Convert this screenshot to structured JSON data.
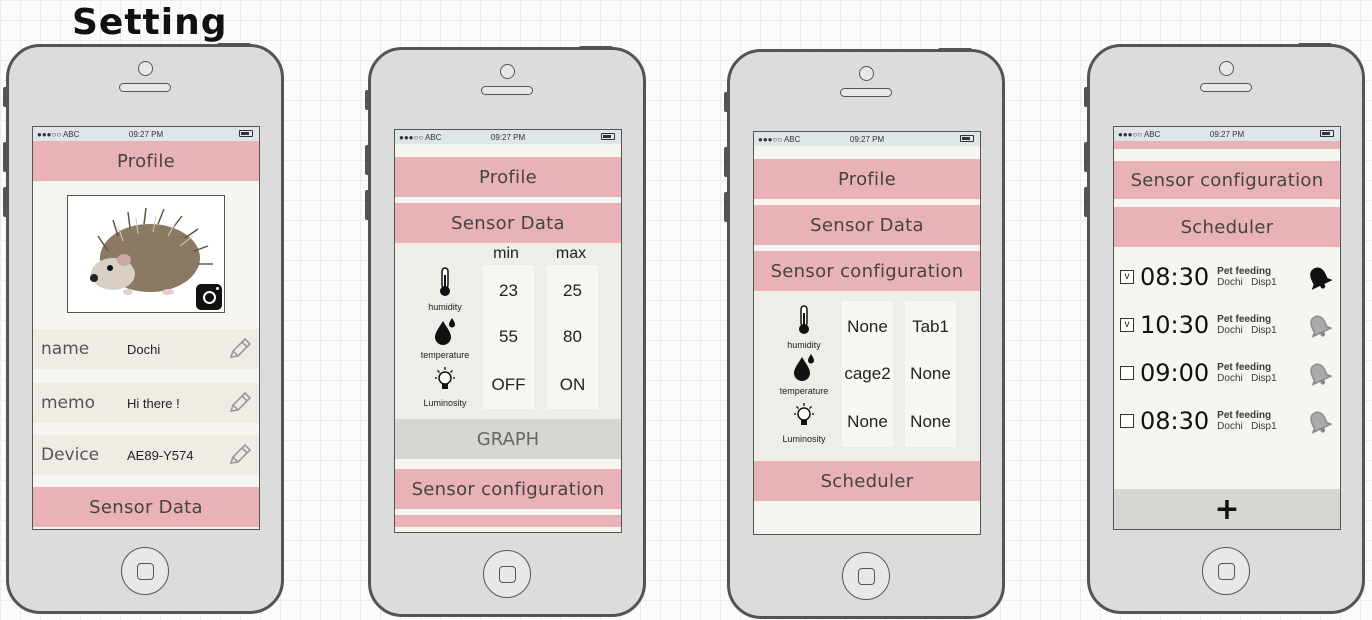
{
  "page_title": "Setting",
  "status": {
    "carrier": "●●●○○ ABC",
    "time": "09:27 PM"
  },
  "screen1": {
    "profile_label": "Profile",
    "fields": [
      {
        "label": "name",
        "value": "Dochi"
      },
      {
        "label": "memo",
        "value": "Hi there !"
      },
      {
        "label": "Device",
        "value": "AE89-Y574"
      }
    ],
    "sensor_data_label": "Sensor Data"
  },
  "screen2": {
    "profile_label": "Profile",
    "sensor_data_label": "Sensor Data",
    "headers": {
      "min": "min",
      "max": "max"
    },
    "sensors": [
      {
        "name": "humidity",
        "icon": "thermometer-icon",
        "min": "23",
        "max": "25"
      },
      {
        "name": "temperature",
        "icon": "drops-icon",
        "min": "55",
        "max": "80"
      },
      {
        "name": "Luminosity",
        "icon": "bulb-icon",
        "min": "OFF",
        "max": "ON"
      }
    ],
    "graph_label": "GRAPH",
    "sensor_config_label": "Sensor configuration"
  },
  "screen3": {
    "profile_label": "Profile",
    "sensor_data_label": "Sensor Data",
    "sensor_config_label": "Sensor configuration",
    "sensors": [
      {
        "name": "humidity",
        "icon": "thermometer-icon",
        "col1": "None",
        "col2": "Tab1"
      },
      {
        "name": "temperature",
        "icon": "drops-icon",
        "col1": "cage2",
        "col2": "None"
      },
      {
        "name": "Luminosity",
        "icon": "bulb-icon",
        "col1": "None",
        "col2": "None"
      }
    ],
    "scheduler_label": "Scheduler"
  },
  "screen4": {
    "sensor_config_label": "Sensor configuration",
    "scheduler_label": "Scheduler",
    "schedules": [
      {
        "checked": true,
        "check_mark": "v",
        "time": "08:30",
        "title": "Pet feeding",
        "pet": "Dochi",
        "device": "Disp1",
        "bell_active": true
      },
      {
        "checked": true,
        "check_mark": "v",
        "time": "10:30",
        "title": "Pet feeding",
        "pet": "Dochi",
        "device": "Disp1",
        "bell_active": false
      },
      {
        "checked": false,
        "check_mark": "",
        "time": "09:00",
        "title": "Pet feeding",
        "pet": "Dochi",
        "device": "Disp1",
        "bell_active": false
      },
      {
        "checked": false,
        "check_mark": "",
        "time": "08:30",
        "title": "Pet feeding",
        "pet": "Dochi",
        "device": "Disp1",
        "bell_active": false
      }
    ],
    "add_label": "+"
  }
}
